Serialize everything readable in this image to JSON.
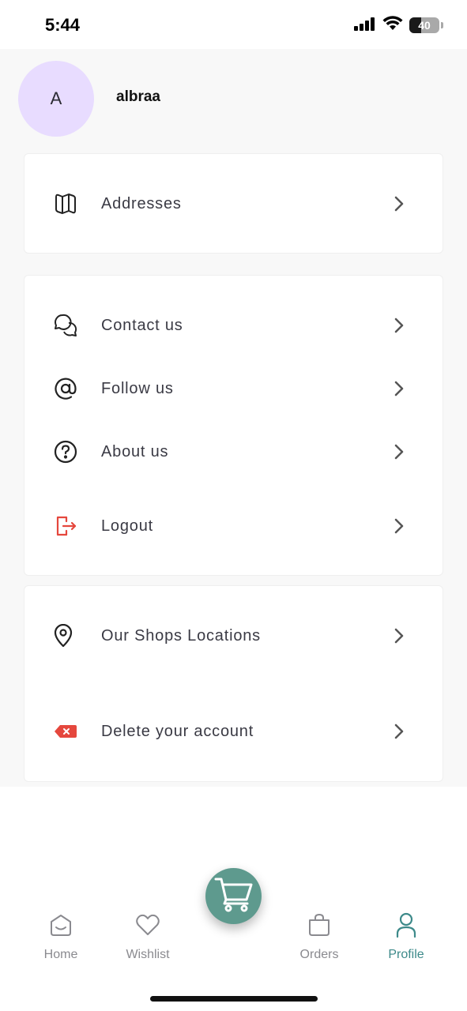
{
  "status_bar": {
    "time": "5:44",
    "battery": "40",
    "battery_level": 0.4,
    "icons": [
      "signal-icon",
      "wifi-icon",
      "battery-icon"
    ]
  },
  "profile": {
    "avatar_initial": "A",
    "username": "albraa"
  },
  "menu": {
    "addresses": {
      "label": "Addresses",
      "icon": "map-icon"
    },
    "contact": {
      "label": "Contact us",
      "icon": "chat-bubbles-icon"
    },
    "follow": {
      "label": "Follow us",
      "icon": "at-sign-icon"
    },
    "about": {
      "label": "About us",
      "icon": "question-circle-icon"
    },
    "logout": {
      "label": "Logout",
      "icon": "logout-icon"
    },
    "shops": {
      "label": "Our Shops Locations",
      "icon": "location-pin-icon"
    },
    "delete": {
      "label": "Delete your account",
      "icon": "delete-tag-icon"
    }
  },
  "nav": {
    "home": "Home",
    "wishlist": "Wishlist",
    "orders": "Orders",
    "profile": "Profile",
    "active": "profile"
  },
  "colors": {
    "accent": "#3d8a8a",
    "cart_fab": "#5e9a8e",
    "danger": "#e5473d",
    "avatar_bg": "#e8dcff"
  }
}
